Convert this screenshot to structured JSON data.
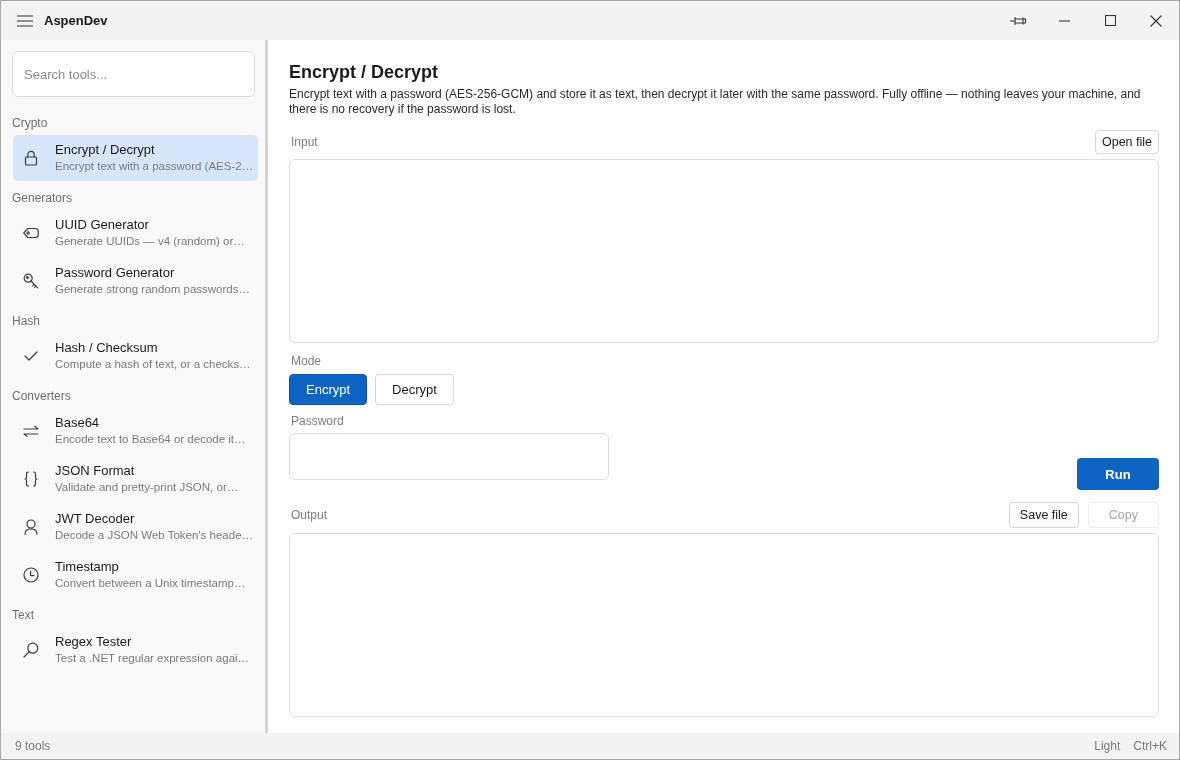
{
  "window": {
    "title": "AspenDev"
  },
  "sidebar": {
    "search": {
      "placeholder": "Search tools..."
    },
    "groups": [
      {
        "label": "Crypto",
        "items": [
          {
            "kind": "cipher",
            "title": "Encrypt / Decrypt",
            "description": "Encrypt text with a password (AES-2…",
            "selected": true
          }
        ]
      },
      {
        "label": "Generators",
        "items": [
          {
            "kind": "uuid",
            "title": "UUID Generator",
            "description": "Generate UUIDs — v4 (random) or…",
            "selected": false
          },
          {
            "kind": "password",
            "title": "Password Generator",
            "description": "Generate strong random passwords…",
            "selected": false
          }
        ]
      },
      {
        "label": "Hash",
        "items": [
          {
            "kind": "hash",
            "title": "Hash / Checksum",
            "description": "Compute a hash of text, or a checks…",
            "selected": false
          }
        ]
      },
      {
        "label": "Converters",
        "items": [
          {
            "kind": "base64",
            "title": "Base64",
            "description": "Encode text to Base64 or decode it…",
            "selected": false
          },
          {
            "kind": "json",
            "title": "JSON Format",
            "description": "Validate and pretty-print JSON, or…",
            "selected": false
          },
          {
            "kind": "jwt",
            "title": "JWT Decoder",
            "description": "Decode a JSON Web Token's heade…",
            "selected": false
          },
          {
            "kind": "timestamp",
            "title": "Timestamp",
            "description": "Convert between a Unix timestamp…",
            "selected": false
          }
        ]
      },
      {
        "label": "Text",
        "items": [
          {
            "kind": "regex",
            "title": "Regex Tester",
            "description": "Test a .NET regular expression agai…",
            "selected": false
          }
        ]
      }
    ]
  },
  "tool": {
    "title": "Encrypt / Decrypt",
    "description": "Encrypt text with a password (AES-256-GCM) and store it as text, then decrypt it later with the same password. Fully offline — nothing leaves your machine, and there is no recovery if the password is lost.",
    "input": {
      "label": "Input",
      "button": "Open file"
    },
    "mode": {
      "label": "Mode",
      "options": [
        {
          "label": "Encrypt",
          "selected": true
        },
        {
          "label": "Decrypt",
          "selected": false
        }
      ]
    },
    "password": {
      "label": "Password"
    },
    "run_button": "Run",
    "output": {
      "label": "Output",
      "buttons": [
        {
          "label": "Save file",
          "disabled": false
        },
        {
          "label": "Copy",
          "disabled": true
        }
      ]
    }
  },
  "status_bar": {
    "count": "9 tools",
    "theme": "Light",
    "shortcut": "Ctrl+K"
  }
}
